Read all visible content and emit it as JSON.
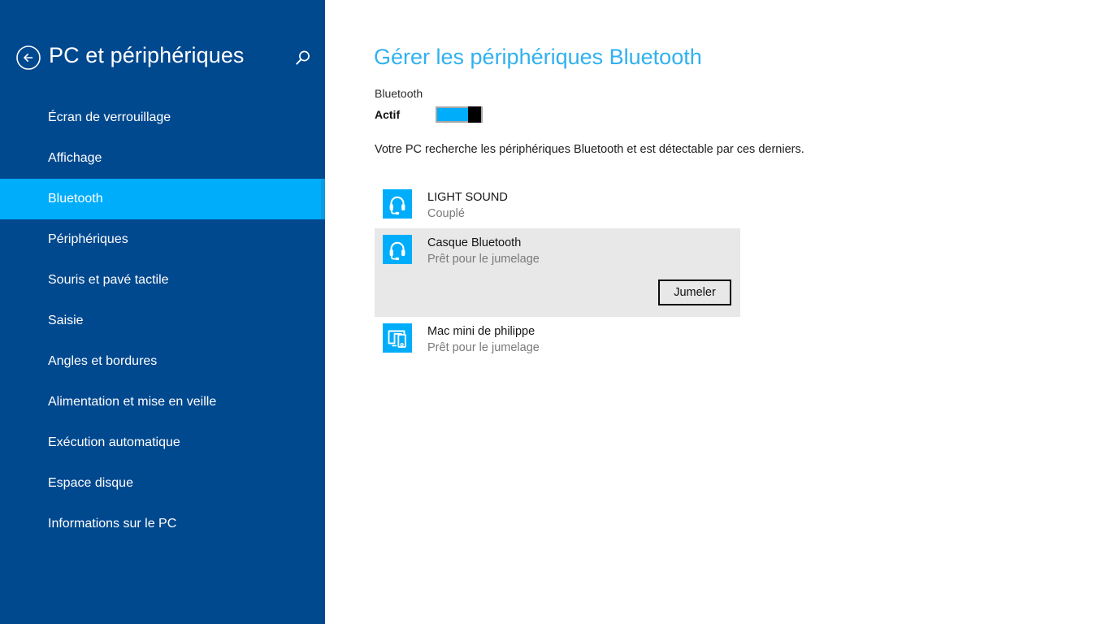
{
  "sidebar": {
    "title": "PC et périphériques",
    "back_icon": "back-arrow-icon",
    "search_icon": "search-icon",
    "items": [
      {
        "label": "Écran de verrouillage",
        "selected": false
      },
      {
        "label": "Affichage",
        "selected": false
      },
      {
        "label": "Bluetooth",
        "selected": true
      },
      {
        "label": "Périphériques",
        "selected": false
      },
      {
        "label": "Souris et pavé tactile",
        "selected": false
      },
      {
        "label": "Saisie",
        "selected": false
      },
      {
        "label": "Angles et bordures",
        "selected": false
      },
      {
        "label": "Alimentation et mise en veille",
        "selected": false
      },
      {
        "label": "Exécution automatique",
        "selected": false
      },
      {
        "label": "Espace disque",
        "selected": false
      },
      {
        "label": "Informations sur le PC",
        "selected": false
      }
    ]
  },
  "main": {
    "title": "Gérer les périphériques Bluetooth",
    "bluetooth_label": "Bluetooth",
    "toggle_state": "Actif",
    "hint": "Votre PC recherche les périphériques Bluetooth et est détectable par ces derniers.",
    "devices": [
      {
        "name": "LIGHT SOUND",
        "status": "Couplé",
        "icon": "headset-icon",
        "selected": false,
        "action": null
      },
      {
        "name": "Casque Bluetooth",
        "status": "Prêt pour le jumelage",
        "icon": "headset-icon",
        "selected": true,
        "action": "Jumeler"
      },
      {
        "name": "Mac mini de philippe",
        "status": "Prêt pour le jumelage",
        "icon": "monitor-phone-icon",
        "selected": false,
        "action": null
      }
    ]
  },
  "colors": {
    "sidebar_bg": "#01498f",
    "accent": "#00adfb",
    "title_accent": "#30b1ef",
    "selected_row_bg": "#e8e8e8"
  }
}
